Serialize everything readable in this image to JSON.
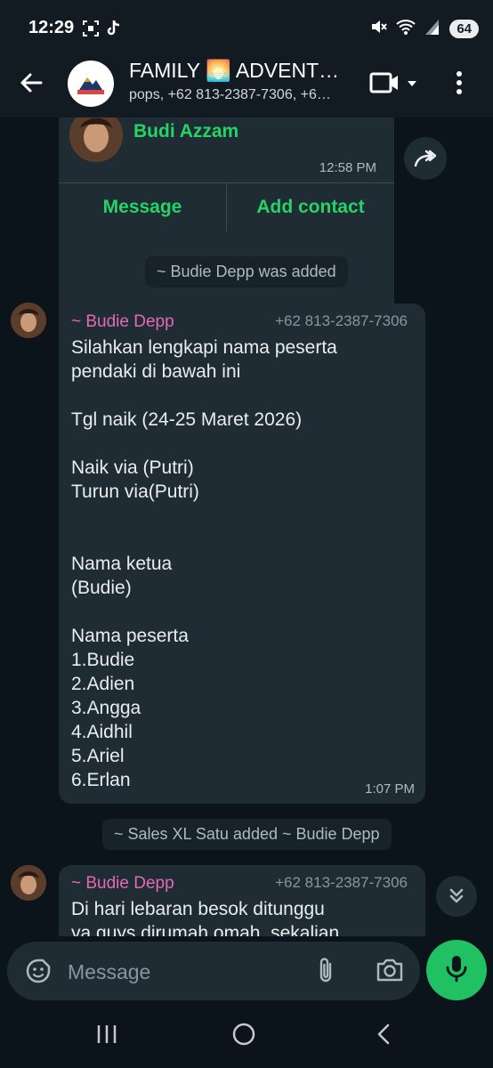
{
  "status_bar": {
    "time": "12:29",
    "battery": "64"
  },
  "header": {
    "title": "FAMILY 🌅 ADVENT…",
    "subtitle": "pops, +62 813-2387-7306, +6…"
  },
  "contact_card": {
    "name": "Budi Azzam",
    "time": "12:58 PM",
    "message_button": "Message",
    "add_contact_button": "Add contact"
  },
  "system_messages": [
    "~ Budie Depp was added",
    "~ Sales XL Satu added ~ Budie Depp"
  ],
  "messages": [
    {
      "sender": "~ Budie Depp",
      "phone": "+62 813-2387-7306",
      "text": "Silahkan lengkapi nama peserta\npendaki di bawah ini\n\nTgl naik (24-25 Maret 2026)\n\nNaik via (Putri)\nTurun via(Putri)\n\n\nNama ketua\n(Budie)\n\nNama peserta\n1.Budie\n2.Adien\n3.Angga\n4.Aidhil\n5.Ariel\n6.Erlan",
      "time": "1:07 PM"
    },
    {
      "sender": "~ Budie Depp",
      "phone": "+62 813-2387-7306",
      "text": "Di hari lebaran besok ditunggu\nya guys dirumah omah, sekalian"
    }
  ],
  "input": {
    "placeholder": "Message"
  },
  "colors": {
    "background": "#0b141a",
    "bubble": "#202c33",
    "accent_green": "#25d366",
    "sender_pink": "#e26ab6",
    "mic_green": "#21c063"
  }
}
